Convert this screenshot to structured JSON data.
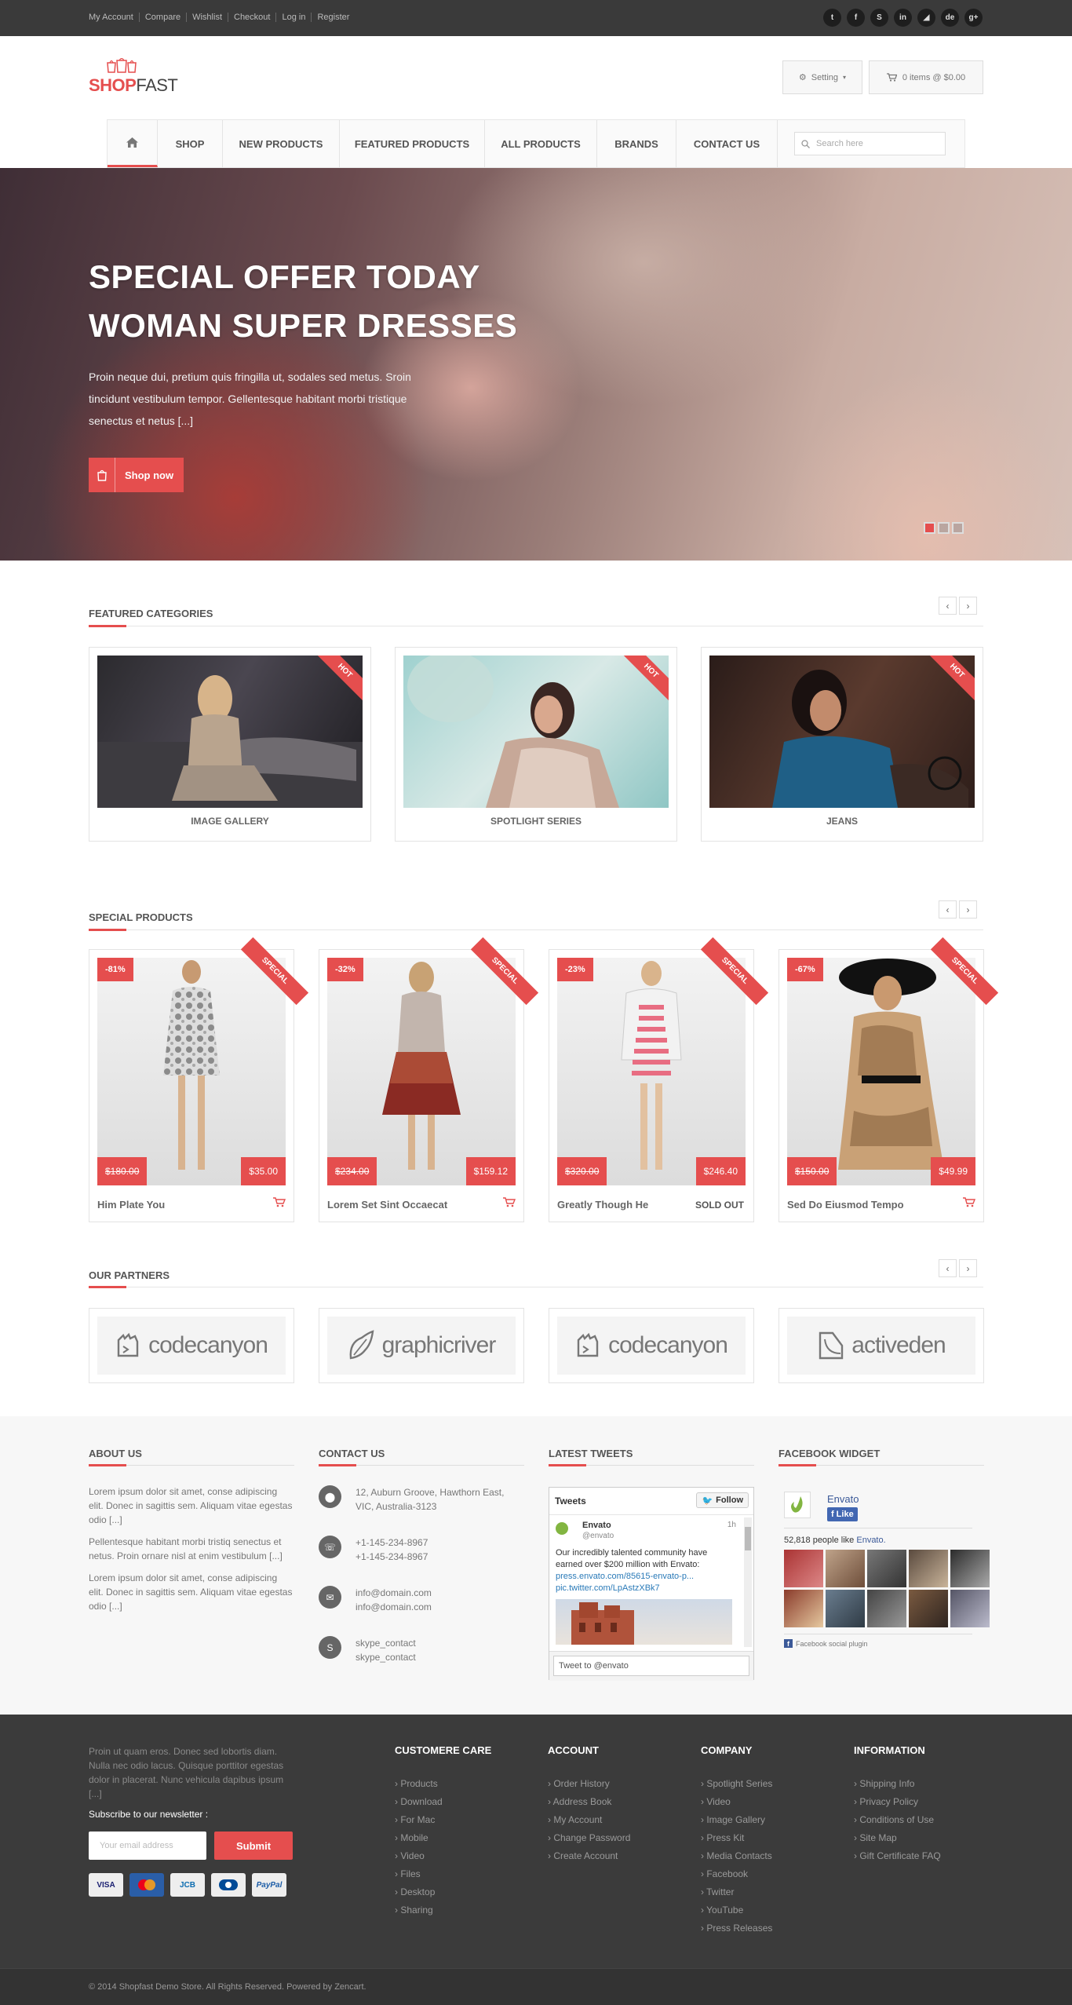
{
  "topbar": {
    "links": [
      "My Account",
      "Compare",
      "Wishlist",
      "Checkout",
      "Log in",
      "Register"
    ],
    "socials": [
      {
        "icon": "twitter-icon",
        "glyph": "t"
      },
      {
        "icon": "facebook-icon",
        "glyph": "f"
      },
      {
        "icon": "skype-icon",
        "glyph": "S"
      },
      {
        "icon": "linkedin-icon",
        "glyph": "in"
      },
      {
        "icon": "rss-icon",
        "glyph": "◢"
      },
      {
        "icon": "deviantart-icon",
        "glyph": "de"
      },
      {
        "icon": "google-plus-icon",
        "glyph": "g+"
      }
    ]
  },
  "header": {
    "logo_shop": "SHOP",
    "logo_fast": "FAST",
    "setting_label": "Setting",
    "cart_label": "0 items @ $0.00"
  },
  "nav": {
    "items": [
      "SHOP",
      "NEW PRODUCTS",
      "FEATURED PRODUCTS",
      "ALL PRODUCTS",
      "BRANDS",
      "CONTACT US"
    ],
    "search_placeholder": "Search here"
  },
  "hero": {
    "title_line1": "SPECIAL OFFER TODAY",
    "title_line2": "WOMAN SUPER DRESSES",
    "desc": "Proin neque dui, pretium quis fringilla ut, sodales sed metus. Sroin tincidunt vestibulum tempor. Gellentesque habitant morbi tristique senectus et netus [...]",
    "button": "Shop now",
    "slide_count": 3,
    "active_slide": 1
  },
  "featured": {
    "title": "FEATURED CATEGORIES",
    "items": [
      {
        "name": "IMAGE GALLERY",
        "badge": "HOT"
      },
      {
        "name": "SPOTLIGHT SERIES",
        "badge": "HOT"
      },
      {
        "name": "JEANS",
        "badge": "HOT"
      }
    ]
  },
  "special": {
    "title": "SPECIAL PRODUCTS",
    "items": [
      {
        "name": "Him Plate You",
        "discount": "-81%",
        "old": "$180.00",
        "new": "$35.00",
        "badge": "SPECIAL",
        "sold_out": ""
      },
      {
        "name": "Lorem Set Sint Occaecat",
        "discount": "-32%",
        "old": "$234.00",
        "new": "$159.12",
        "badge": "SPECIAL",
        "sold_out": ""
      },
      {
        "name": "Greatly Though He",
        "discount": "-23%",
        "old": "$320.00",
        "new": "$246.40",
        "badge": "SPECIAL",
        "sold_out": "SOLD OUT"
      },
      {
        "name": "Sed Do Eiusmod Tempo",
        "discount": "-67%",
        "old": "$150.00",
        "new": "$49.99",
        "badge": "SPECIAL",
        "sold_out": ""
      }
    ]
  },
  "partners": {
    "title": "OUR PARTNERS",
    "items": [
      "codecanyon",
      "graphicriver",
      "codecanyon",
      "activeden"
    ]
  },
  "widgets": {
    "about": {
      "title": "ABOUT US",
      "paras": [
        "Lorem ipsum dolor sit amet, conse adipiscing elit. Donec in sagittis sem. Aliquam vitae egestas odio [...]",
        "Pellentesque habitant morbi tristiq senectus et netus. Proin ornare nisl at enim vestibulum [...]",
        "Lorem ipsum dolor sit amet, conse adipiscing elit. Donec in sagittis sem. Aliquam vitae egestas odio [...]"
      ]
    },
    "contact": {
      "title": "CONTACT US",
      "address1": "12, Auburn Groove, Hawthorn East,",
      "address2": "VIC, Australia-3123",
      "phone1": "+1-145-234-8967",
      "phone2": "+1-145-234-8967",
      "email1": "info@domain.com",
      "email2": "info@domain.com",
      "skype1": "skype_contact",
      "skype2": "skype_contact"
    },
    "tweets": {
      "title": "LATEST TWEETS",
      "header": "Tweets",
      "follow": "Follow",
      "user": "Envato",
      "handle": "@envato",
      "time": "1h",
      "text": "Our incredibly talented community have earned over $200 million with Envato:",
      "link1": "press.envato.com/85615-envato-p...",
      "link2": "pic.twitter.com/LpAstzXBk7",
      "input_placeholder": "Tweet to @envato"
    },
    "facebook": {
      "title": "FACEBOOK WIDGET",
      "page": "Envato",
      "like": "Like",
      "likes_count": "52,818 people like",
      "likes_page": "Envato.",
      "plugin": "Facebook social plugin"
    }
  },
  "footer": {
    "about": "Proin ut quam eros. Donec sed lobortis diam. Nulla nec odio lacus. Quisque porttitor egestas dolor in placerat. Nunc vehicula dapibus ipsum [...]",
    "newsletter_label": "Subscribe to our newsletter :",
    "email_placeholder": "Your email address",
    "submit": "Submit",
    "cards": [
      "VISA",
      "MC",
      "JCB",
      "DC",
      "PayPal"
    ],
    "cols": [
      {
        "title": "CUSTOMERE CARE",
        "items": [
          "Products",
          "Download",
          "For Mac",
          "Mobile",
          "Video",
          "Files",
          "Desktop",
          "Sharing"
        ]
      },
      {
        "title": "ACCOUNT",
        "items": [
          "Order History",
          "Address Book",
          "My Account",
          "Change Password",
          "Create Account"
        ]
      },
      {
        "title": "COMPANY",
        "items": [
          "Spotlight Series",
          "Video",
          "Image Gallery",
          "Press Kit",
          "Media Contacts",
          "Facebook",
          "Twitter",
          "YouTube",
          "Press Releases"
        ]
      },
      {
        "title": "INFORMATION",
        "items": [
          "Shipping Info",
          "Privacy Policy",
          "Conditions of Use",
          "Site Map",
          "Gift Certificate FAQ"
        ]
      }
    ],
    "copyright": "© 2014 Shopfast Demo Store. All Rights Reserved. Powered by Zencart."
  },
  "colors": {
    "accent": "#e54e4e",
    "dark": "#3a3a3a"
  }
}
